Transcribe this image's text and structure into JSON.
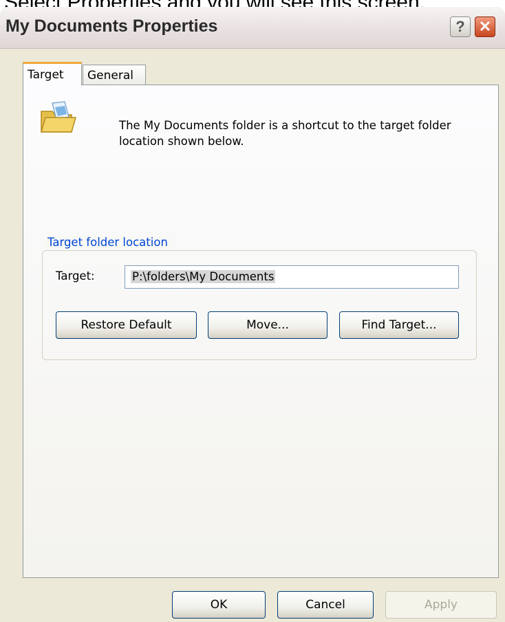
{
  "caption": "Select Properties and you will see this screen.",
  "window": {
    "title": "My Documents Properties",
    "help_label": "?",
    "close_label": "✕"
  },
  "tabs": [
    {
      "label": "Target",
      "active": true
    },
    {
      "label": "General",
      "active": false
    }
  ],
  "panel": {
    "icon": "folder-shortcut-icon",
    "description": "The My Documents folder is a shortcut to the target folder location shown below.",
    "group_title": "Target folder location",
    "target_label": "Target:",
    "target_value": "P:\\folders\\My Documents",
    "buttons": {
      "restore": "Restore Default",
      "move": "Move...",
      "find": "Find Target..."
    }
  },
  "dialog_buttons": {
    "ok": "OK",
    "cancel": "Cancel",
    "apply": "Apply"
  },
  "colors": {
    "dialog_bg": "#ece9d8",
    "active_tab_accent": "#f3a73a",
    "group_label": "#0046d5",
    "close_button": "#c8461f"
  }
}
